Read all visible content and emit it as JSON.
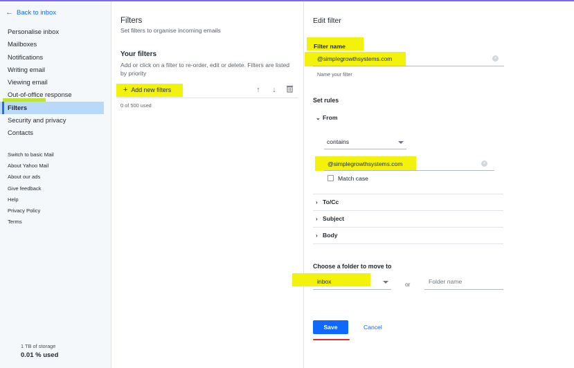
{
  "sidebar": {
    "back_label": "Back to inbox",
    "items": [
      {
        "label": "Personalise inbox"
      },
      {
        "label": "Mailboxes"
      },
      {
        "label": "Notifications"
      },
      {
        "label": "Writing email"
      },
      {
        "label": "Viewing email"
      },
      {
        "label": "Out-of-office response"
      },
      {
        "label": "Filters"
      },
      {
        "label": "Security and privacy"
      },
      {
        "label": "Contacts"
      }
    ],
    "links": [
      {
        "label": "Switch to basic Mail"
      },
      {
        "label": "About Yahoo Mail"
      },
      {
        "label": "About our ads"
      },
      {
        "label": "Give feedback"
      },
      {
        "label": "Help"
      },
      {
        "label": "Privacy Policy"
      },
      {
        "label": "Terms"
      }
    ],
    "storage_label": "1 TB of storage",
    "storage_used": "0.01 % used"
  },
  "filters": {
    "title": "Filters",
    "subtitle": "Set filters to organise incoming emails",
    "your_filters": "Your filters",
    "description": "Add or click on a filter to re-order, edit or delete. Filters are listed by priority",
    "add_label": "Add new filters",
    "used": "0 of 500 used"
  },
  "edit": {
    "title": "Edit filter",
    "filter_name_label": "Filter name",
    "filter_name_value": "@simplegrowthsystems.com",
    "filter_name_helper": "Name your filter",
    "set_rules": "Set rules",
    "from_label": "From",
    "from_condition": "contains",
    "from_value": "@simplegrowthsystems.com",
    "match_case": "Match case",
    "to_cc_label": "To/Cc",
    "subject_label": "Subject",
    "body_label": "Body",
    "choose_folder": "Choose a folder to move to",
    "folder_value": "inbox",
    "or_label": "or",
    "folder_name_placeholder": "Folder name",
    "save_label": "Save",
    "cancel_label": "Cancel"
  },
  "colors": {
    "accent": "#0f69ff",
    "highlight_yellow": "#f2f20a",
    "highlight_green": "#b6e01c",
    "active_item": "#b9d9f9",
    "save_underline": "#e0262b"
  }
}
